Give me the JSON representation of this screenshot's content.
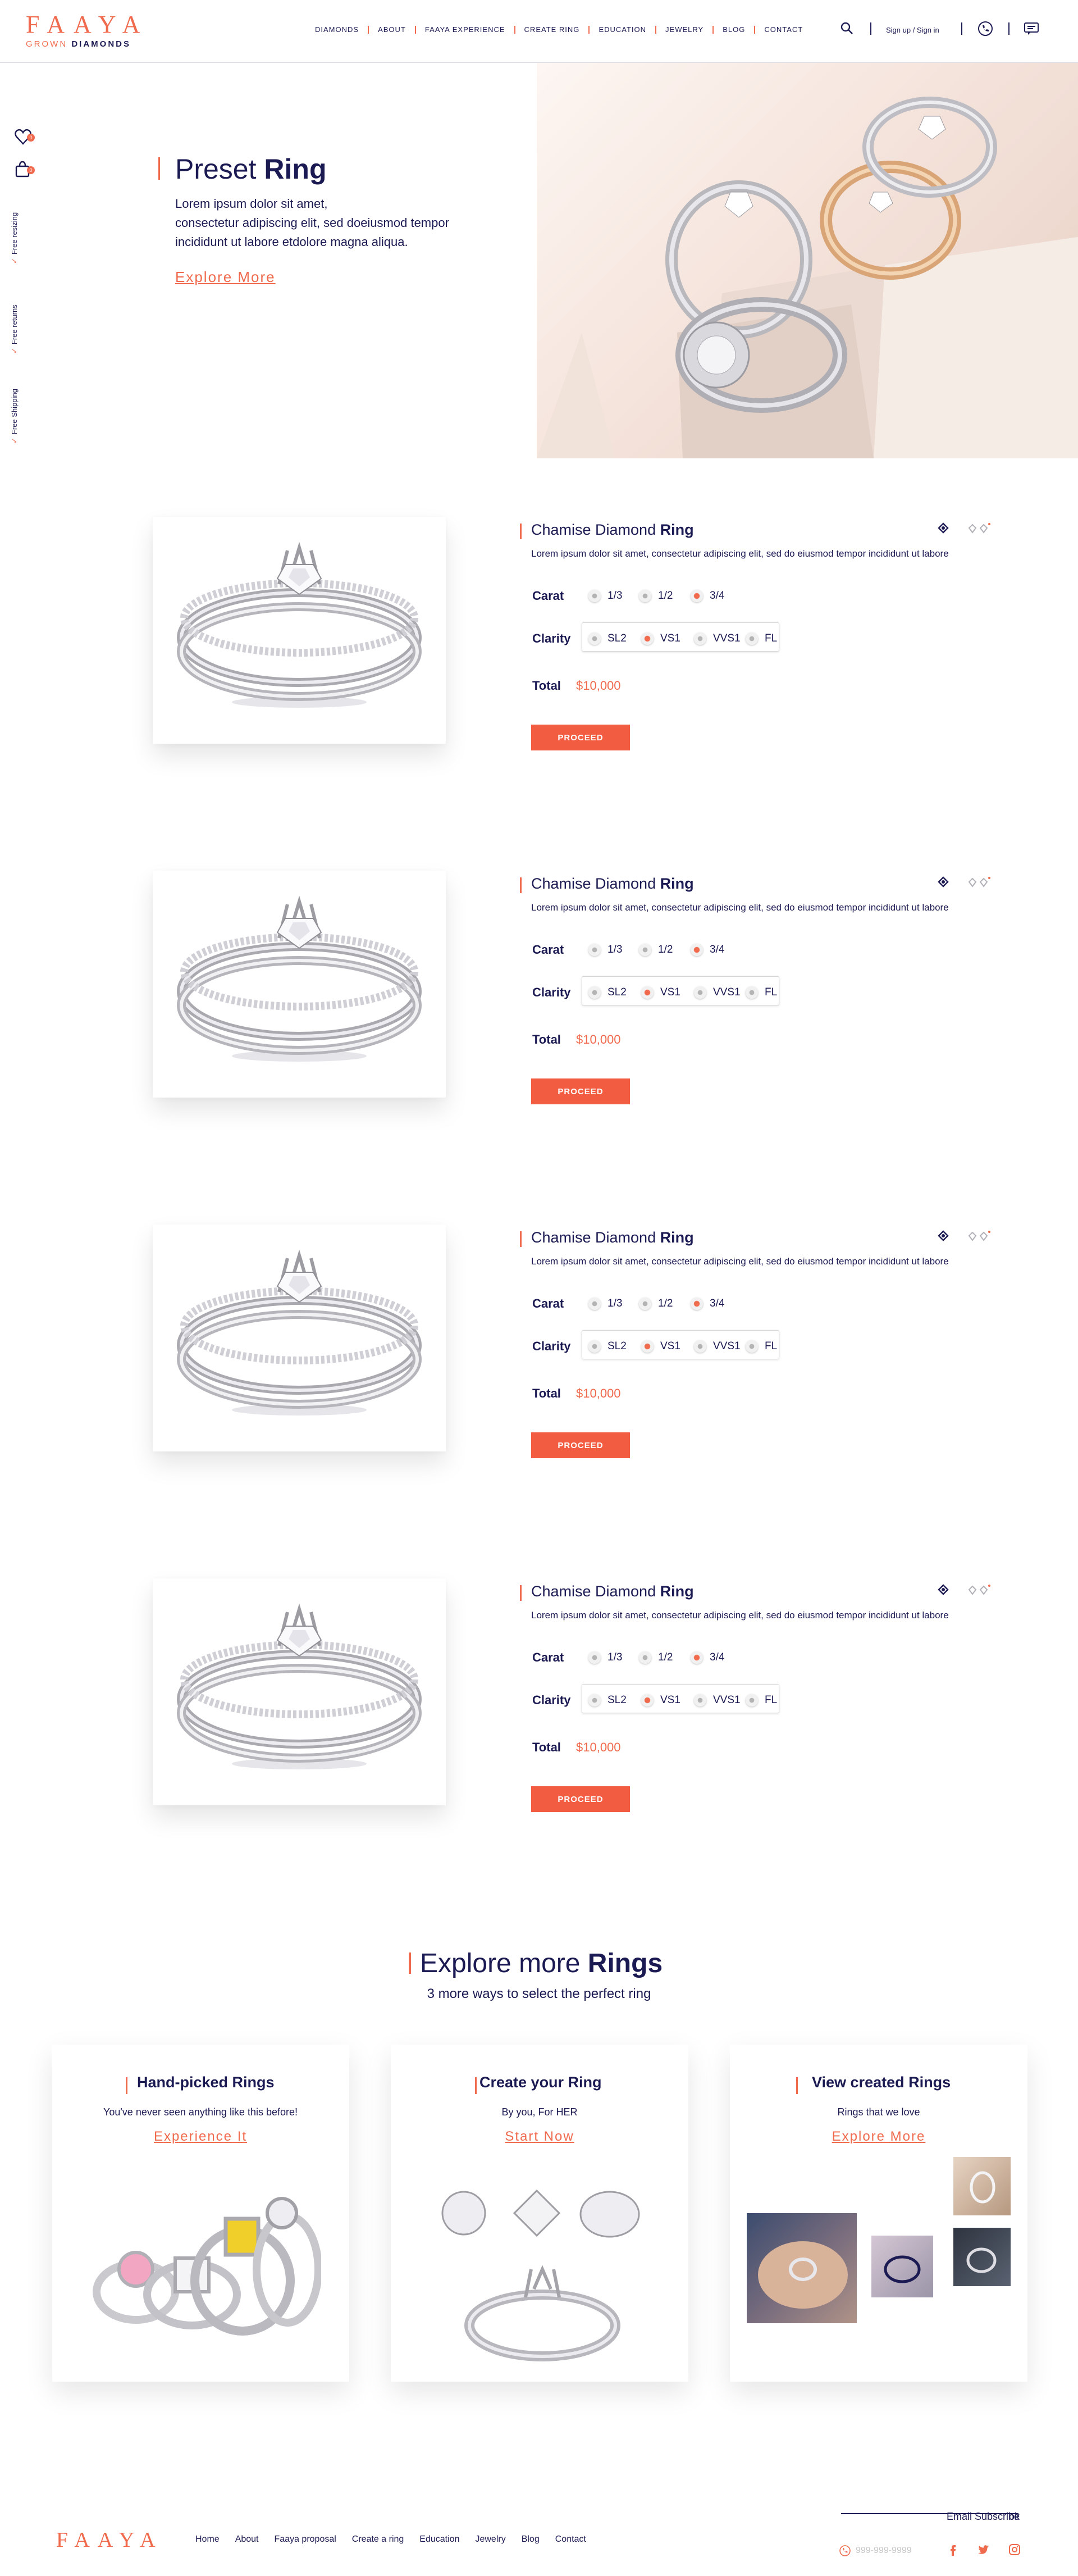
{
  "brand": {
    "name": "FAAYA",
    "sub_grown": "GROWN",
    "sub_diamonds": "DIAMONDS"
  },
  "nav": {
    "items": [
      "DIAMONDS",
      "ABOUT",
      "FAAYA EXPERIENCE",
      "CREATE RING",
      "EDUCATION",
      "JEWELRY",
      "BLOG",
      "CONTACT"
    ]
  },
  "header": {
    "sign_in": "Sign up / Sign in"
  },
  "sidebar": {
    "cart_count": "0",
    "bag_count": "0",
    "features": [
      "Free resizing",
      "Free returns",
      "Free Shipping"
    ]
  },
  "hero": {
    "title_light": "Preset",
    "title_bold": "Ring",
    "text_lines": [
      "Lorem ipsum dolor sit amet,",
      "consectetur adipiscing elit, sed doeiusmod tempor",
      "incididunt ut labore etdolore magna aliqua."
    ],
    "link": "Explore More"
  },
  "products": [
    {
      "title_light": "Chamise Diamond",
      "title_bold": "Ring",
      "description": "Lorem ipsum dolor sit amet, consectetur adipiscing elit, sed do eiusmod tempor incididunt ut labore",
      "carat_label": "Carat",
      "carat_options": [
        "1/3",
        "1/2",
        "3/4"
      ],
      "carat_selected": "3/4",
      "clarity_label": "Clarity",
      "clarity_options": [
        "SL2",
        "VS1",
        "VVS1",
        "FL"
      ],
      "clarity_selected": "VS1",
      "total_label": "Total",
      "total_value": "$10,000",
      "button": "PROCEED"
    },
    {
      "title_light": "Chamise Diamond",
      "title_bold": "Ring",
      "description": "Lorem ipsum dolor sit amet, consectetur adipiscing elit, sed do eiusmod tempor incididunt ut labore",
      "carat_label": "Carat",
      "carat_options": [
        "1/3",
        "1/2",
        "3/4"
      ],
      "carat_selected": "3/4",
      "clarity_label": "Clarity",
      "clarity_options": [
        "SL2",
        "VS1",
        "VVS1",
        "FL"
      ],
      "clarity_selected": "VS1",
      "total_label": "Total",
      "total_value": "$10,000",
      "button": "PROCEED"
    },
    {
      "title_light": "Chamise Diamond",
      "title_bold": "Ring",
      "description": "Lorem ipsum dolor sit amet, consectetur adipiscing elit, sed do eiusmod tempor incididunt ut labore",
      "carat_label": "Carat",
      "carat_options": [
        "1/3",
        "1/2",
        "3/4"
      ],
      "carat_selected": "3/4",
      "clarity_label": "Clarity",
      "clarity_options": [
        "SL2",
        "VS1",
        "VVS1",
        "FL"
      ],
      "clarity_selected": "VS1",
      "total_label": "Total",
      "total_value": "$10,000",
      "button": "PROCEED"
    },
    {
      "title_light": "Chamise Diamond",
      "title_bold": "Ring",
      "description": "Lorem ipsum dolor sit amet, consectetur adipiscing elit, sed do eiusmod tempor incididunt ut labore",
      "carat_label": "Carat",
      "carat_options": [
        "1/3",
        "1/2",
        "3/4"
      ],
      "carat_selected": "3/4",
      "clarity_label": "Clarity",
      "clarity_options": [
        "SL2",
        "VS1",
        "VVS1",
        "FL"
      ],
      "clarity_selected": "VS1",
      "total_label": "Total",
      "total_value": "$10,000",
      "button": "PROCEED"
    }
  ],
  "explore": {
    "title_light": "Explore more",
    "title_bold": "Rings",
    "subtitle": "3 more ways to select the perfect ring",
    "cards": [
      {
        "title": "Hand-picked Rings",
        "subtitle": "You've never seen anything like this before!",
        "link": "Experience It"
      },
      {
        "title": "Create your Ring",
        "subtitle": "By you, For HER",
        "link": "Start Now"
      },
      {
        "title": "View created Rings",
        "subtitle": "Rings that we love",
        "link": "Explore More"
      }
    ]
  },
  "footer": {
    "logo": "FAAYA",
    "nav": [
      "Home",
      "About",
      "Faaya proposal",
      "Create a ring",
      "Education",
      "Jewelry",
      "Blog",
      "Contact"
    ],
    "subscribe_placeholder": "Email Subscribe",
    "subscribe_ok": "ok",
    "phone": "999-999-9999"
  },
  "colors": {
    "accent": "#f06a4d",
    "navy": "#1c1a52"
  }
}
